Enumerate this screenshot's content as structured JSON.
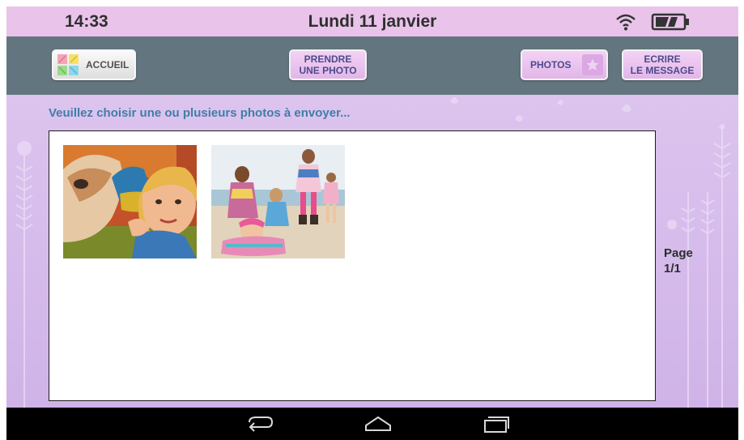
{
  "status_bar": {
    "time": "14:33",
    "date": "Lundi 11 janvier",
    "icons": [
      "wifi-icon",
      "battery-icon"
    ]
  },
  "toolbar": {
    "accueil_label": "ACCUEIL",
    "prendre_label_line1": "PRENDRE",
    "prendre_label_line2": "UNE PHOTO",
    "photos_label": "PHOTOS",
    "ecrire_label_line1": "ECRIRE",
    "ecrire_label_line2": "LE MESSAGE"
  },
  "main": {
    "instruction": "Veuillez choisir une ou plusieurs photos à envoyer...",
    "photos": [
      {
        "subject": "child with carousel horse"
      },
      {
        "subject": "children playing on beach"
      }
    ],
    "page_label": "Page",
    "page_value": "1/1"
  },
  "navbar": {
    "icons": [
      "back-icon",
      "home-icon",
      "recent-apps-icon"
    ]
  },
  "colors": {
    "status_bar": "#e9c3ea",
    "toolbar": "#637680",
    "content_bg": "#d8bfee",
    "instruction_text": "#3f7fa6",
    "button_text": "#4b4b8b"
  }
}
